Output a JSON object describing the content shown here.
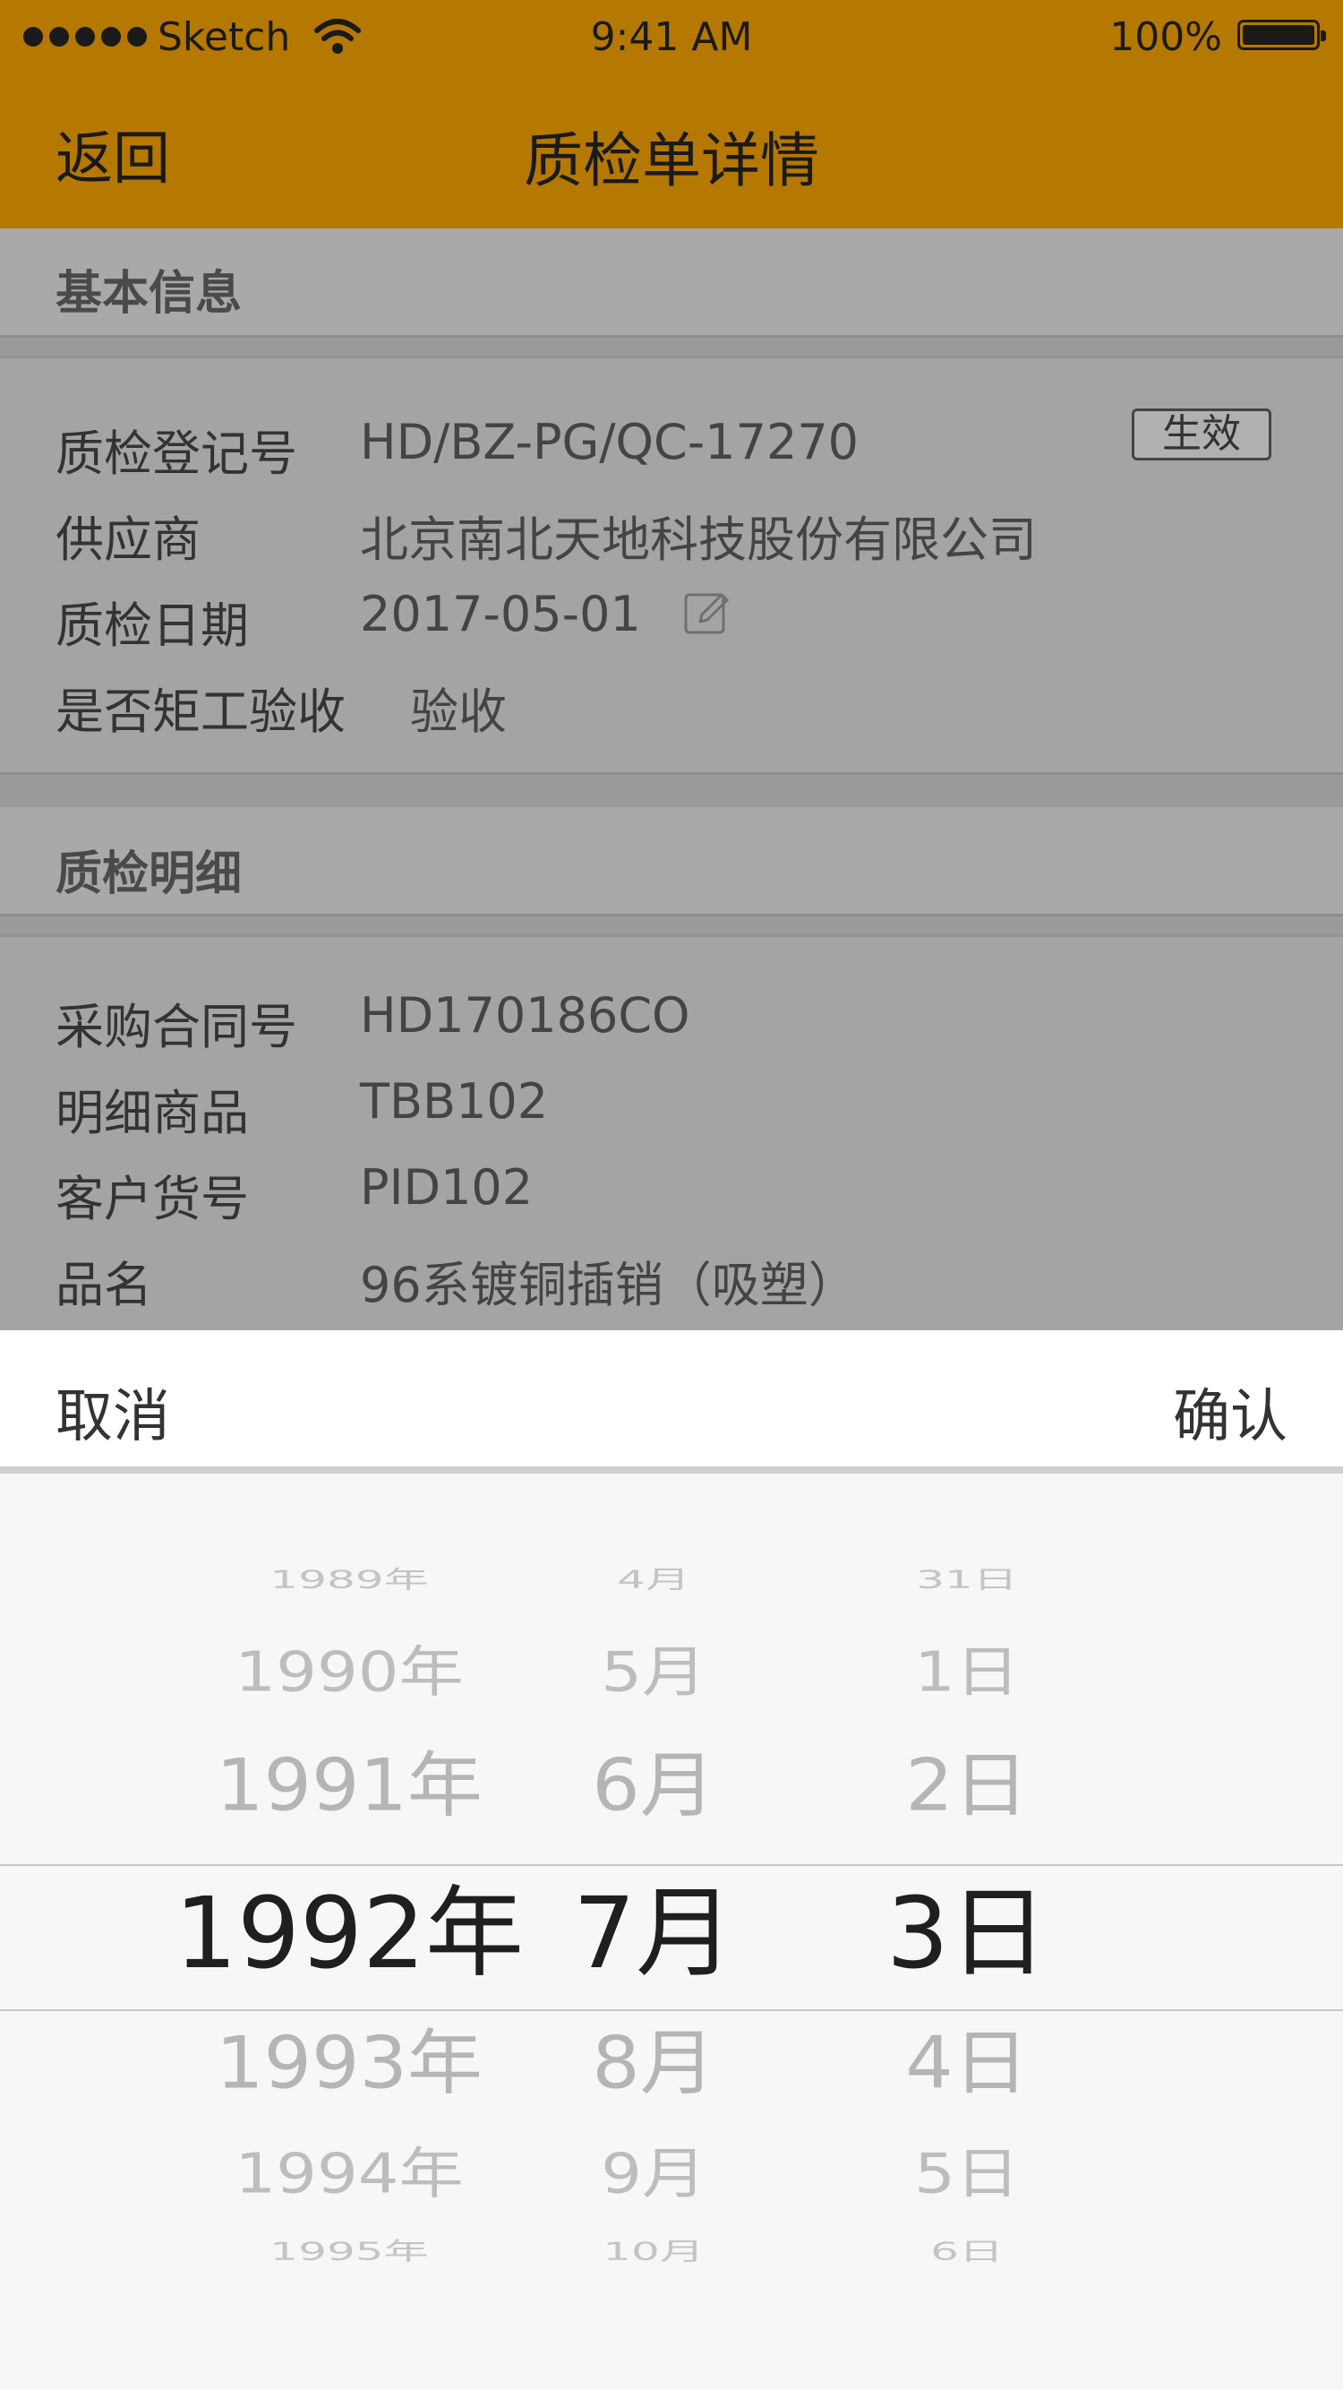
{
  "status_bar": {
    "carrier": "Sketch",
    "time": "9:41 AM",
    "battery": "100%"
  },
  "nav": {
    "back_label": "返回",
    "title": "质检单详情"
  },
  "basic_info": {
    "header": "基本信息",
    "inspection_no_label": "质检登记号",
    "inspection_no": "HD/BZ-PG/QC-17270",
    "status_badge": "生效",
    "supplier_label": "供应商",
    "supplier": "北京南北天地科技股份有限公司",
    "date_label": "质检日期",
    "date": "2017-05-01",
    "accept_label": "是否矩工验收",
    "accept_value": "验收"
  },
  "details": {
    "header": "质检明细",
    "contract_label": "采购合同号",
    "contract": "HD170186CO",
    "item_label": "明细商品",
    "item": "TBB102",
    "customer_no_label": "客户货号",
    "customer_no": "PID102",
    "name_label": "品名",
    "name": "96系镀铜插销（吸塑）"
  },
  "picker": {
    "cancel_label": "取消",
    "confirm_label": "确认",
    "years": [
      "1989年",
      "1990年",
      "1991年",
      "1992年",
      "1993年",
      "1994年",
      "1995年"
    ],
    "months": [
      "4月",
      "5月",
      "6月",
      "7月",
      "8月",
      "9月",
      "10月"
    ],
    "days": [
      "31日",
      "1日",
      "2日",
      "3日",
      "4日",
      "5日",
      "6日"
    ],
    "selected": {
      "year": "1992年",
      "month": "7月",
      "day": "3日"
    }
  },
  "colors": {
    "accent": "#b57800",
    "overlay_gray": "#a9a9a9",
    "picker_bg": "#f7f7f7"
  }
}
